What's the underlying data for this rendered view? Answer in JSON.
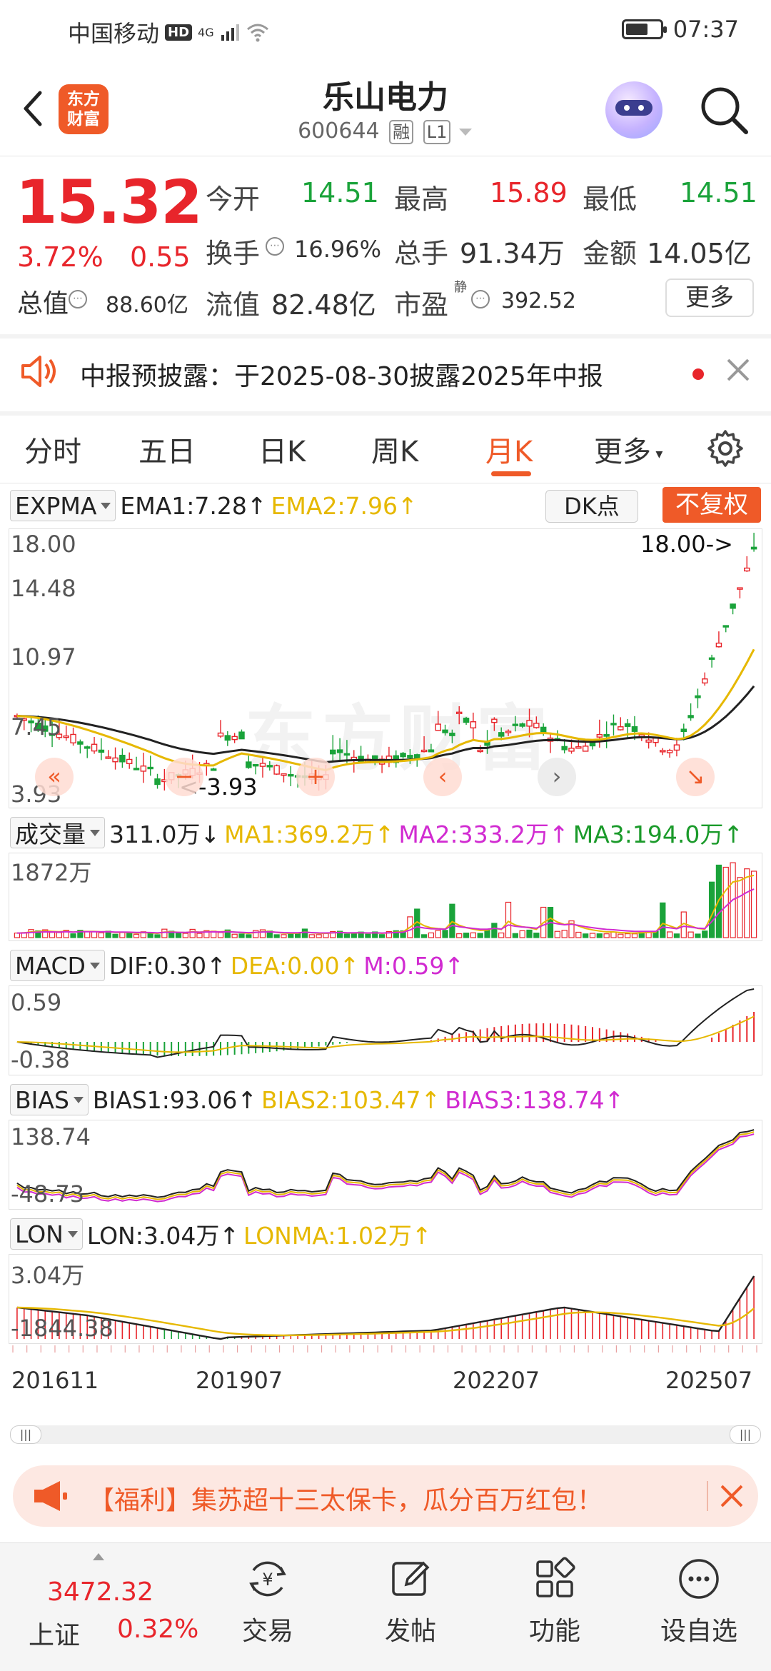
{
  "status_bar": {
    "carrier": "中国移动",
    "hd": "HD",
    "net": "4G",
    "time": "07:37"
  },
  "header": {
    "stock_name": "乐山电力",
    "stock_code": "600644",
    "tag_margin": "融",
    "tag_level": "L1"
  },
  "quote": {
    "price": "15.32",
    "change_pct": "3.72%",
    "change": "0.55",
    "open_label": "今开",
    "open": "14.51",
    "high_label": "最高",
    "high": "15.89",
    "low_label": "最低",
    "low": "14.51",
    "turnover_label": "换手",
    "turnover": "16.96%",
    "volume_label": "总手",
    "volume": "91.34万",
    "amount_label": "金额",
    "amount": "14.05亿",
    "mktcap_label": "总值",
    "mktcap": "88.60亿",
    "float_label": "流值",
    "float_cap": "82.48亿",
    "pe_label": "市盈",
    "pe_sup": "静",
    "pe": "392.52",
    "more": "更多"
  },
  "notice": {
    "text": "中报预披露：于2025-08-30披露2025年中报"
  },
  "tabs": [
    "分时",
    "五日",
    "日K",
    "周K",
    "月K",
    "更多"
  ],
  "active_tab": "月K",
  "main_chart": {
    "indicator": "EXPMA",
    "ema1": "EMA1:7.28↑",
    "ema2": "EMA2:7.96↑",
    "dk": "DK点",
    "adjust": "不复权",
    "y_labels": [
      "18.00",
      "14.48",
      "10.97",
      "7.45",
      "3.93"
    ],
    "max_note": "18.00->",
    "min_note": "<-3.93",
    "watermark": "东方财富"
  },
  "volume_panel": {
    "indicator": "成交量",
    "value": "311.0万↓",
    "ma1": "MA1:369.2万↑",
    "ma2": "MA2:333.2万↑",
    "ma3": "MA3:194.0万↑",
    "max": "1872万"
  },
  "macd_panel": {
    "indicator": "MACD",
    "dif": "DIF:0.30↑",
    "dea": "DEA:0.00↑",
    "m": "M:0.59↑",
    "top": "0.59",
    "bottom": "-0.38"
  },
  "bias_panel": {
    "indicator": "BIAS",
    "bias1": "BIAS1:93.06↑",
    "bias2": "BIAS2:103.47↑",
    "bias3": "BIAS3:138.74↑",
    "top": "138.74",
    "bottom": "-48.73"
  },
  "lon_panel": {
    "indicator": "LON",
    "lon": "LON:3.04万↑",
    "lonma": "LONMA:1.02万↑",
    "top": "3.04万",
    "bottom": "-1844.38"
  },
  "x_axis": [
    "201611",
    "201907",
    "202207",
    "202507"
  ],
  "promo": {
    "text": "【福利】集苏超十三太保卡，瓜分百万红包！"
  },
  "bottom_bar": {
    "index_value": "3472.32",
    "index_name": "上证",
    "index_pct": "0.32%",
    "items": [
      "交易",
      "发帖",
      "功能",
      "设自选"
    ]
  },
  "colors": {
    "up": "#e8252b",
    "down": "#1aa33a",
    "accent": "#ef5a28",
    "ema1": "#222222",
    "ema2": "#e6b800",
    "ma2": "#d12bd1"
  }
}
